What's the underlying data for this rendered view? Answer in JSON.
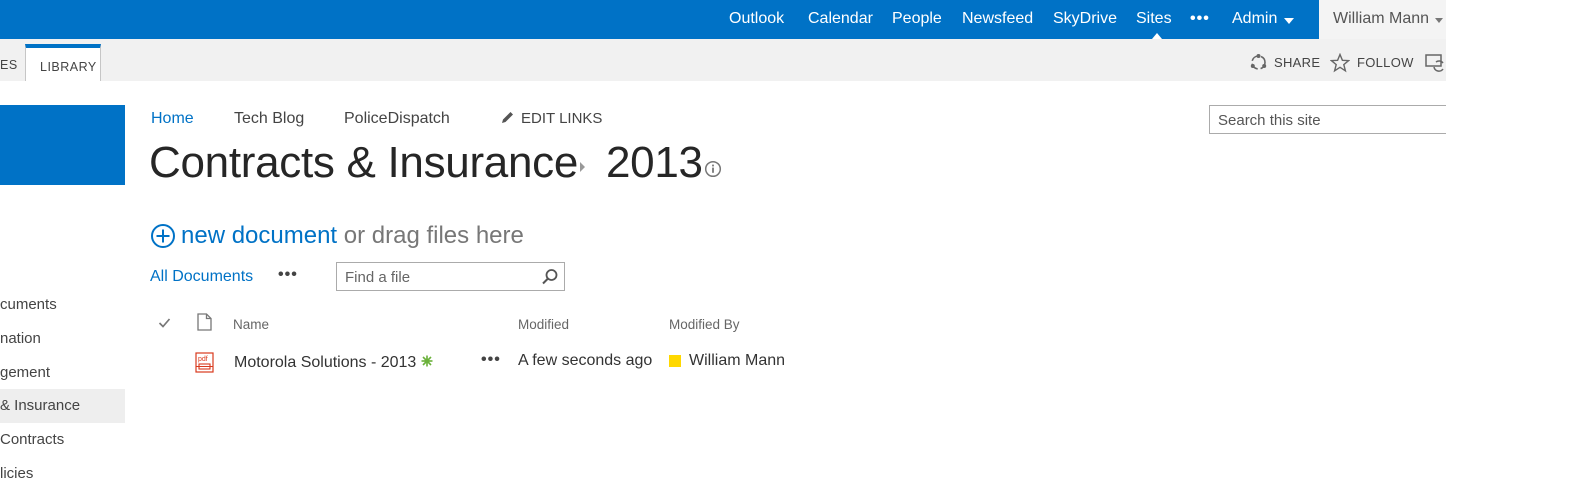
{
  "suite_bar": {
    "links": [
      "Outlook",
      "Calendar",
      "People",
      "Newsfeed",
      "SkyDrive",
      "Sites"
    ],
    "more": "•••",
    "admin_label": "Admin",
    "user_name": "William Mann",
    "bg_color": "#0072c6"
  },
  "ribbon": {
    "tabs": [
      "ES",
      "LIBRARY"
    ],
    "share_label": "SHARE",
    "follow_label": "FOLLOW"
  },
  "left_nav": {
    "items": [
      "cuments",
      "nation",
      "gement",
      "& Insurance",
      "Contracts",
      "licies"
    ]
  },
  "top_nav": {
    "links": [
      "Home",
      "Tech Blog",
      "PoliceDispatch"
    ],
    "edit_links_label": "EDIT LINKS"
  },
  "site_search": {
    "placeholder": "Search this site"
  },
  "page_title": {
    "parent": "Contracts & Insurance",
    "current": "2013"
  },
  "new_document": {
    "link_label": "new document",
    "rest_label": "or drag files here"
  },
  "views": {
    "current_view": "All Documents",
    "more": "•••"
  },
  "find_file": {
    "placeholder": "Find a file"
  },
  "list": {
    "columns": {
      "name": "Name",
      "modified": "Modified",
      "modified_by": "Modified By"
    },
    "rows": [
      {
        "name": "Motorola Solutions - 2013",
        "file_type_icon": "pdf-icon",
        "modified": "A few seconds ago",
        "modified_by": "William Mann",
        "presence_color": "#ffd800",
        "more": "•••"
      }
    ]
  },
  "colors": {
    "accent": "#0072c6",
    "new_badge": "#6bb13b",
    "pdf_icon": "#d9391d"
  }
}
